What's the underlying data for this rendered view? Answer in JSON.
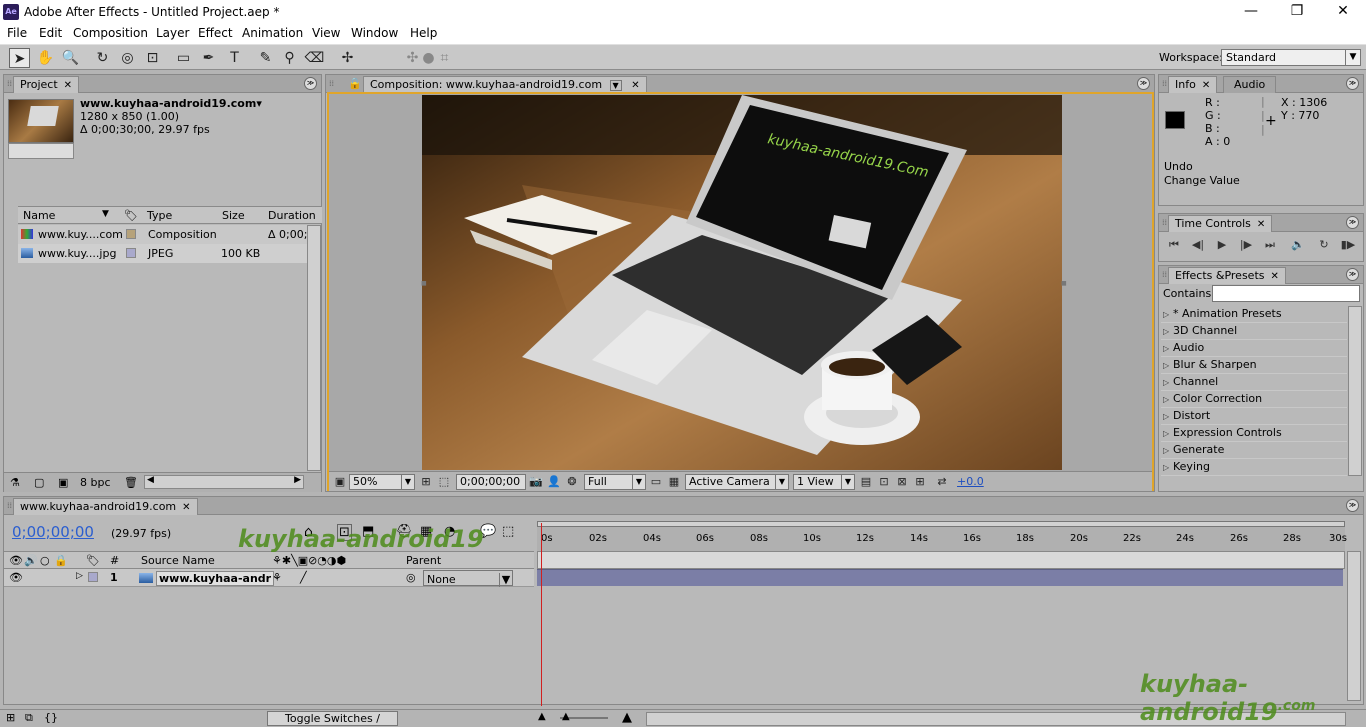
{
  "window": {
    "title": "Adobe After Effects - Untitled Project.aep *",
    "app_icon": "Ae",
    "minimize": "—",
    "maximize": "❐",
    "close": "✕"
  },
  "menu": [
    "File",
    "Edit",
    "Composition",
    "Layer",
    "Effect",
    "Animation",
    "View",
    "Window",
    "Help"
  ],
  "toolbar": {
    "workspace_label": "Workspace:",
    "workspace_value": "Standard"
  },
  "project": {
    "tab": "Project",
    "item_name": "www.kuyhaa-android19.com",
    "item_dims": "1280 x 850 (1.00)",
    "item_duration": "Δ 0;00;30;00, 29.97 fps",
    "columns": {
      "name": "Name",
      "type": "Type",
      "size": "Size",
      "duration": "Duration"
    },
    "rows": [
      {
        "name": "www.kuy....com",
        "type": "Composition",
        "size": "",
        "duration": "Δ 0;00;"
      },
      {
        "name": "www.kuy....jpg",
        "type": "JPEG",
        "size": "100 KB",
        "duration": ""
      }
    ],
    "bpc": "8 bpc"
  },
  "composition": {
    "tab": "Composition: www.kuyhaa-android19.com",
    "zoom": "50%",
    "timecode": "0;00;00;00",
    "resolution": "Full",
    "camera": "Active Camera",
    "view": "1 View",
    "exposure": "+0.0",
    "screen_title": "kuyhaa-android19.Com"
  },
  "info": {
    "tab_info": "Info",
    "tab_audio": "Audio",
    "r": "R :",
    "g": "G :",
    "b": "B :",
    "a": "A : 0",
    "x": "X : 1306",
    "y": "Y : 770",
    "undo": "Undo",
    "undo_detail": "Change Value"
  },
  "time_controls": {
    "tab": "Time Controls"
  },
  "effects": {
    "tab": "Effects &Presets",
    "contains_label": "Contains:",
    "items": [
      "* Animation Presets",
      "3D Channel",
      "Audio",
      "Blur & Sharpen",
      "Channel",
      "Color Correction",
      "Distort",
      "Expression Controls",
      "Generate",
      "Keying"
    ]
  },
  "timeline": {
    "tab": "www.kuyhaa-android19.com",
    "time": "0;00;00;00",
    "fps": "(29.97 fps)",
    "col_num": "#",
    "col_source": "Source Name",
    "col_parent": "Parent",
    "layer_num": "1",
    "layer_name": "www.kuyhaa-andr",
    "parent_value": "None",
    "ticks": [
      "0s",
      "02s",
      "04s",
      "06s",
      "08s",
      "10s",
      "12s",
      "14s",
      "16s",
      "18s",
      "20s",
      "22s",
      "24s",
      "26s",
      "28s",
      "30s"
    ],
    "toggle_label": "Toggle Switches / Modes"
  },
  "watermark": "kuyhaa-android19",
  "watermark_suffix": ".com"
}
